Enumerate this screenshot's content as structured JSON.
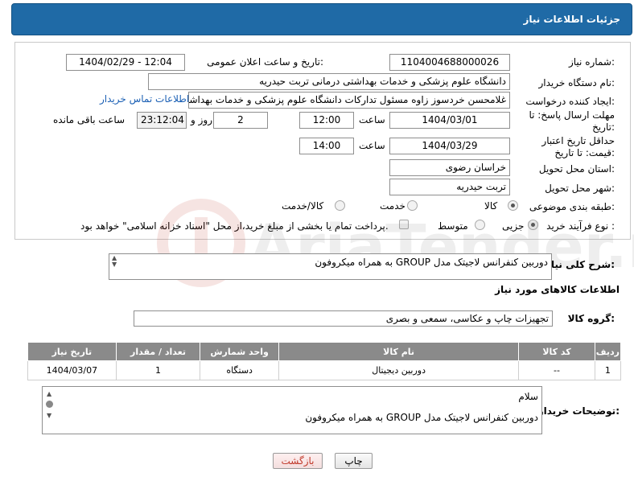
{
  "header": {
    "title": "جزئیات اطلاعات نیاز"
  },
  "form": {
    "need_number_label": "شماره نیاز:",
    "need_number": "1104004688000026",
    "announce_label": "تاریخ و ساعت اعلان عمومی:",
    "announce_value": "1404/02/29 - 12:04",
    "buyer_org_label": "نام دستگاه خریدار:",
    "buyer_org": "دانشگاه علوم پزشکی و خدمات بهداشتی درمانی تربت حیدریه",
    "creator_label": "ایجاد کننده درخواست:",
    "creator": "غلامحسن خردسوز زاوه مسئول تدارکات دانشگاه علوم پزشکی و خدمات بهداشتی درمانی تربت حیدریه",
    "contact_link": "اطلاعات تماس خریدار",
    "reply_deadline_label": "مهلت ارسال پاسخ: تا تاریخ:",
    "reply_date": "1404/03/01",
    "time_label": "ساعت",
    "reply_time": "12:00",
    "days_value": "2",
    "days_label": "روز و",
    "remaining_time": "23:12:04",
    "remaining_label": "ساعت باقی مانده",
    "price_deadline_label": "حداقل تاریخ اعتبار قیمت: تا تاریخ:",
    "price_date": "1404/03/29",
    "price_time": "14:00",
    "province_label": "استان محل تحویل:",
    "province": "خراسان رضوی",
    "city_label": "شهر محل تحویل:",
    "city": "تربت حیدریه",
    "category_label": "طبقه بندی موضوعی:",
    "category_options": [
      "کالا",
      "خدمت",
      "کالا/خدمت"
    ],
    "process_label": "نوع فرآیند خرید :",
    "process_options": [
      "جزیی",
      "متوسط"
    ],
    "payment_note": "پرداخت تمام یا بخشی از مبلغ خرید،از محل \"اسناد خزانه اسلامی\" خواهد بود."
  },
  "summary": {
    "label": "شرح کلی نیاز:",
    "text": "دوربین کنفرانس لاجیتک مدل GROUP به همراه میکروفون"
  },
  "goods_section": {
    "title": "اطلاعات کالاهای مورد نیاز",
    "group_label": "گروه کالا:",
    "group_value": "تجهیزات چاپ و عکاسی، سمعی و بصری"
  },
  "table": {
    "headers": [
      "ردیف",
      "کد کالا",
      "نام کالا",
      "واحد شمارش",
      "تعداد / مقدار",
      "تاریخ نیاز"
    ],
    "rows": [
      [
        "1",
        "--",
        "دوربین دیجیتال",
        "دستگاه",
        "1",
        "1404/03/07"
      ]
    ]
  },
  "buyer_notes": {
    "label": "توضیحات خریدار:",
    "line1": "سلام",
    "line2": "دوربین کنفرانس لاجیتک مدل GROUP به همراه میکروفون"
  },
  "buttons": {
    "print": "چاپ",
    "back": "بازگشت"
  },
  "watermark_text": "AriaTender.net",
  "colors": {
    "header_bg": "#1f6aa6",
    "link": "#1a5fb4",
    "back_btn_text": "#c0392b"
  }
}
